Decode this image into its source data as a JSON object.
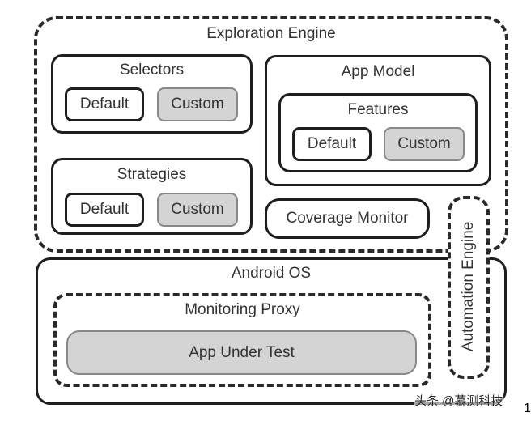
{
  "exploration_engine": {
    "title": "Exploration Engine",
    "selectors": {
      "title": "Selectors",
      "default": "Default",
      "custom": "Custom"
    },
    "strategies": {
      "title": "Strategies",
      "default": "Default",
      "custom": "Custom"
    },
    "app_model": {
      "title": "App Model",
      "features": {
        "title": "Features",
        "default": "Default",
        "custom": "Custom"
      }
    },
    "coverage_monitor": "Coverage Monitor"
  },
  "android_os": {
    "title": "Android OS",
    "monitoring_proxy": {
      "title": "Monitoring Proxy",
      "app_under_test": "App Under Test"
    }
  },
  "automation_engine": "Automation Engine",
  "watermark": "头条 @慕测科技",
  "corner_mark": "1",
  "colors": {
    "border": "#1e1e1e",
    "custom_fill": "#d4d4d4"
  }
}
